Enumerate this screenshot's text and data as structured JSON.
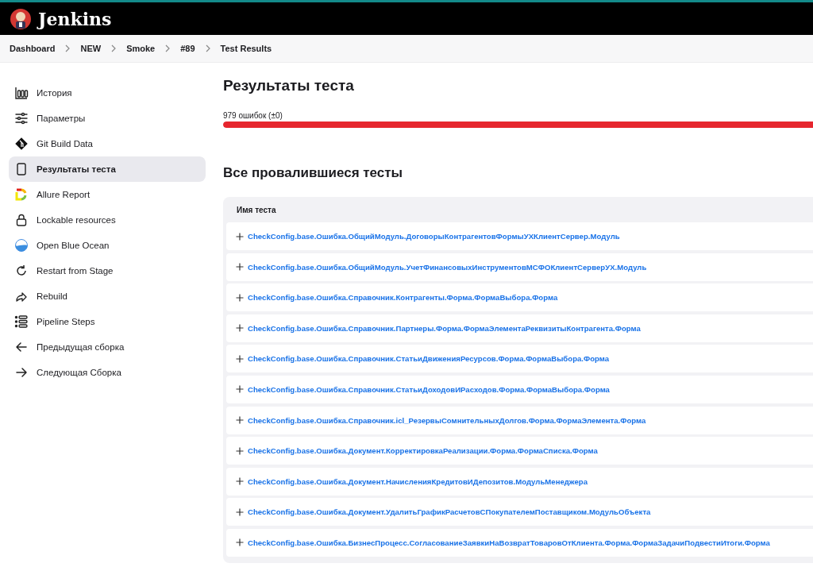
{
  "header": {
    "title": "Jenkins"
  },
  "breadcrumbs": [
    "Dashboard",
    "NEW",
    "Smoke",
    "#89",
    "Test Results"
  ],
  "sidebar": {
    "items": [
      {
        "label": "История",
        "selected": false
      },
      {
        "label": "Параметры",
        "selected": false
      },
      {
        "label": "Git Build Data",
        "selected": false
      },
      {
        "label": "Результаты теста",
        "selected": true
      },
      {
        "label": "Allure Report",
        "selected": false
      },
      {
        "label": "Lockable resources",
        "selected": false
      },
      {
        "label": "Open Blue Ocean",
        "selected": false
      },
      {
        "label": "Restart from Stage",
        "selected": false
      },
      {
        "label": "Rebuild",
        "selected": false
      },
      {
        "label": "Pipeline Steps",
        "selected": false
      },
      {
        "label": "Предыдущая сборка",
        "selected": false
      },
      {
        "label": "Следующая Сборка",
        "selected": false
      }
    ]
  },
  "main": {
    "title": "Результаты теста",
    "summary": "979 ошибок (±0)",
    "failure_bar": {
      "level": 1
    },
    "failed_section": {
      "title": "Все провалившиеся тесты",
      "column": "Имя теста",
      "rows": [
        "CheckConfig.base.Ошибка.ОбщийМодуль.ДоговорыКонтрагентовФормыУХКлиентСервер.Модуль",
        "CheckConfig.base.Ошибка.ОбщийМодуль.УчетФинансовыхИнструментовМСФОКлиентСерверУХ.Модуль",
        "CheckConfig.base.Ошибка.Справочник.Контрагенты.Форма.ФормаВыбора.Форма",
        "CheckConfig.base.Ошибка.Справочник.Партнеры.Форма.ФормаЭлементаРеквизитыКонтрагента.Форма",
        "CheckConfig.base.Ошибка.Справочник.СтатьиДвиженияРесурсов.Форма.ФормаВыбора.Форма",
        "CheckConfig.base.Ошибка.Справочник.СтатьиДоходовИРасходов.Форма.ФормаВыбора.Форма",
        "CheckConfig.base.Ошибка.Справочник.icl_РезервыСомнительныхДолгов.Форма.ФормаЭлемента.Форма",
        "CheckConfig.base.Ошибка.Документ.КорректировкаРеализации.Форма.ФормаСписка.Форма",
        "CheckConfig.base.Ошибка.Документ.НачисленияКредитовИДепозитов.МодульМенеджера",
        "CheckConfig.base.Ошибка.Документ.УдалитьГрафикРасчетовСПокупателемПоставщиком.МодульОбъекта",
        "CheckConfig.base.Ошибка.БизнесПроцесс.СогласованиеЗаявкиНаВозвратТоваровОтКлиента.Форма.ФормаЗадачиПодвестиИтоги.Форма"
      ]
    }
  }
}
